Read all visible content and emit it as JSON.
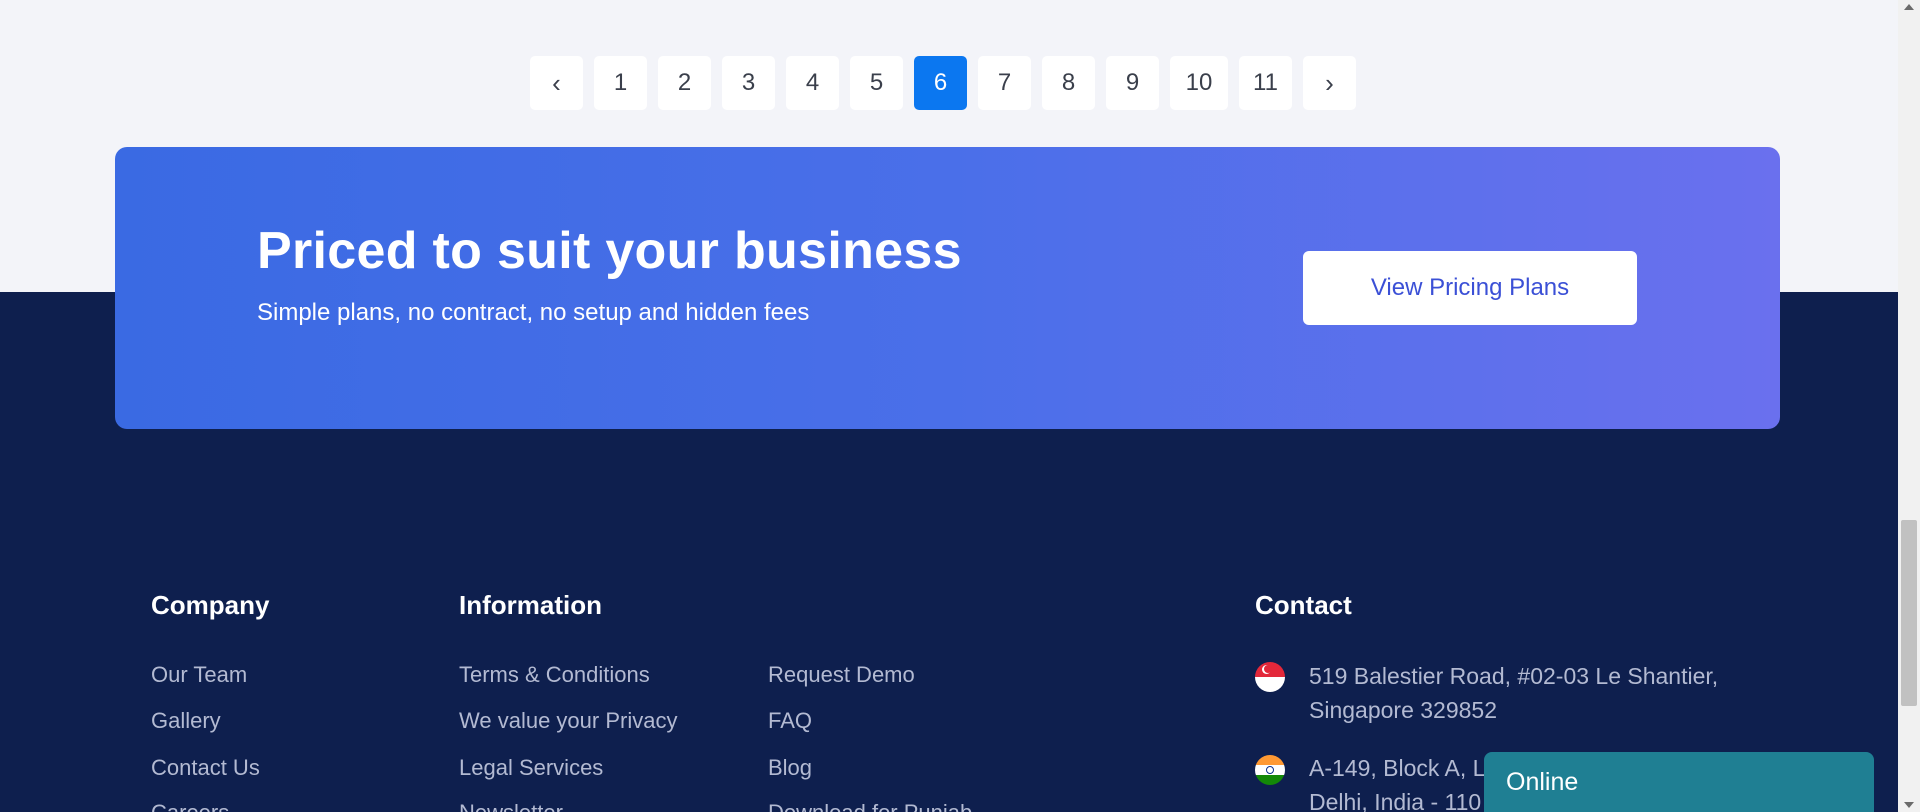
{
  "pagination": {
    "prev": "‹",
    "next": "›",
    "pages": [
      "1",
      "2",
      "3",
      "4",
      "5",
      "6",
      "7",
      "8",
      "9",
      "10",
      "11"
    ],
    "active": "6"
  },
  "cta": {
    "title": "Priced to suit your business",
    "subtitle": "Simple plans, no contract, no setup and hidden fees",
    "button": "View Pricing Plans"
  },
  "footer": {
    "company": {
      "title": "Company",
      "links": [
        "Our Team",
        "Gallery",
        "Contact Us",
        "Careers"
      ]
    },
    "information": {
      "title": "Information",
      "links_col1": [
        "Terms & Conditions",
        "We value your Privacy",
        "Legal Services",
        "Newsletter"
      ],
      "links_col2": [
        "Request Demo",
        "FAQ",
        "Blog",
        "Download for Punjab"
      ]
    },
    "contact": {
      "title": "Contact",
      "addresses": [
        {
          "flag": "singapore-flag-icon",
          "line1": "519 Balestier Road, #02-03 Le Shantier,",
          "line2": "Singapore 329852"
        },
        {
          "flag": "india-flag-icon",
          "line1": "A-149, Block A, L",
          "line2": "Delhi, India - 110"
        }
      ]
    }
  },
  "chat": {
    "label": "Online"
  },
  "colors": {
    "active_page": "#0b77f0",
    "footer_bg": "#0e1f4e",
    "chat_bg": "#1f7f93"
  }
}
